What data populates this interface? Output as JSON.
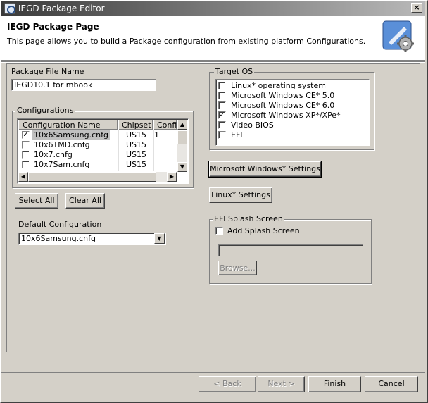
{
  "window": {
    "title": "IEGD Package Editor",
    "close_glyph": "×"
  },
  "header": {
    "title": "IEGD Package Page",
    "description": "This page allows you to build a Package configuration from existing platform Configurations.",
    "icon": "settings-gear-icon"
  },
  "package_file": {
    "label": "Package File Name",
    "value": "IEGD10.1 for mbook"
  },
  "configurations": {
    "group_label": "Configurations",
    "columns": [
      "Configuration Name",
      "Chipset",
      "Confi"
    ],
    "rows": [
      {
        "name": "10x6Samsung.cnfg",
        "chipset": "US15",
        "config": "1",
        "checked": true,
        "selected": true
      },
      {
        "name": "10x6TMD.cnfg",
        "chipset": "US15",
        "config": "",
        "checked": false,
        "selected": false
      },
      {
        "name": "10x7.cnfg",
        "chipset": "US15",
        "config": "",
        "checked": false,
        "selected": false
      },
      {
        "name": "10x7Sam.cnfg",
        "chipset": "US15",
        "config": "",
        "checked": false,
        "selected": false
      }
    ],
    "select_all": "Select All",
    "clear_all": "Clear All"
  },
  "default_config": {
    "label": "Default Configuration",
    "value": "10x6Samsung.cnfg"
  },
  "target_os": {
    "group_label": "Target OS",
    "items": [
      {
        "label": "Linux* operating system",
        "checked": false
      },
      {
        "label": "Microsoft Windows CE* 5.0",
        "checked": false
      },
      {
        "label": "Microsoft Windows CE* 6.0",
        "checked": false
      },
      {
        "label": "Microsoft Windows XP*/XPe*",
        "checked": true
      },
      {
        "label": "Video BIOS",
        "checked": false
      },
      {
        "label": "EFI",
        "checked": false
      }
    ]
  },
  "os_buttons": {
    "windows_settings": "Microsoft Windows* Settings",
    "linux_settings": "Linux* Settings"
  },
  "efi_splash": {
    "group_label": "EFI Splash Screen",
    "add_label": "Add Splash Screen",
    "add_checked": false,
    "path_value": "",
    "browse": "Browse..."
  },
  "footer": {
    "back": "< Back",
    "next": "Next >",
    "finish": "Finish",
    "cancel": "Cancel"
  },
  "colors": {
    "selection": "#c0c0c0",
    "title_gradient_start": "#3a3a3a"
  }
}
